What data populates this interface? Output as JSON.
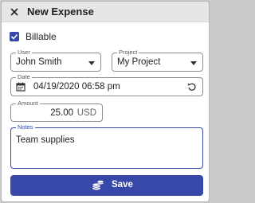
{
  "dialog": {
    "title": "New Expense",
    "close_icon": "close-icon"
  },
  "billable": {
    "label": "Billable",
    "checked": true
  },
  "user": {
    "label": "User",
    "value": "John Smith"
  },
  "project": {
    "label": "Project",
    "value": "My Project"
  },
  "date": {
    "label": "Date",
    "value": "04/19/2020 06:58 pm",
    "icon": "calendar-icon",
    "reset_icon": "reset-icon"
  },
  "amount": {
    "label": "Amount",
    "value": "25.00",
    "currency": "USD"
  },
  "notes": {
    "label": "Notes",
    "value": "Team supplies"
  },
  "save": {
    "label": "Save",
    "icon": "coins-icon"
  },
  "colors": {
    "accent": "#3848a8",
    "header_bg": "#e6e6e6",
    "border": "#8d8d8d"
  }
}
